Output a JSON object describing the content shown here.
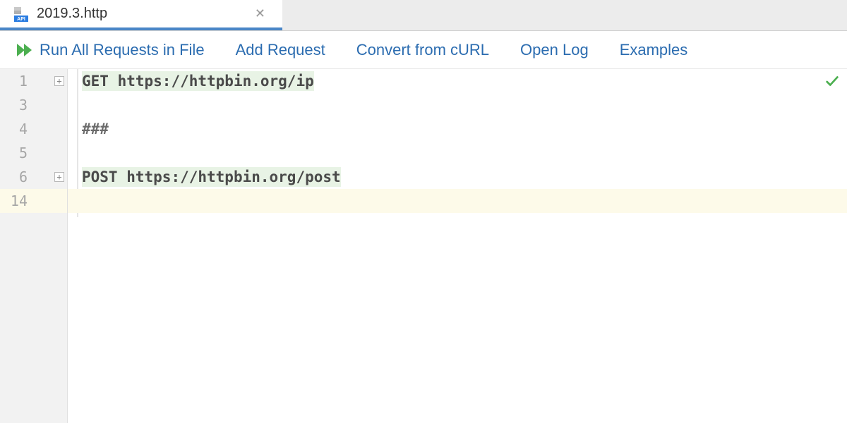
{
  "tab": {
    "title": "2019.3.http",
    "icon_label": "API"
  },
  "toolbar": {
    "run_all": "Run All Requests in File",
    "add_request": "Add Request",
    "convert_curl": "Convert from cURL",
    "open_log": "Open Log",
    "examples": "Examples"
  },
  "editor": {
    "lines": [
      {
        "num": "1",
        "type": "request",
        "method": "GET",
        "url": "https://httpbin.org/ip",
        "fold": true
      },
      {
        "num": "3",
        "type": "blank"
      },
      {
        "num": "4",
        "type": "separator",
        "text": "###"
      },
      {
        "num": "5",
        "type": "blank"
      },
      {
        "num": "6",
        "type": "request",
        "method": "POST",
        "url": "https://httpbin.org/post",
        "fold": true
      },
      {
        "num": "14",
        "type": "current-blank"
      }
    ]
  }
}
